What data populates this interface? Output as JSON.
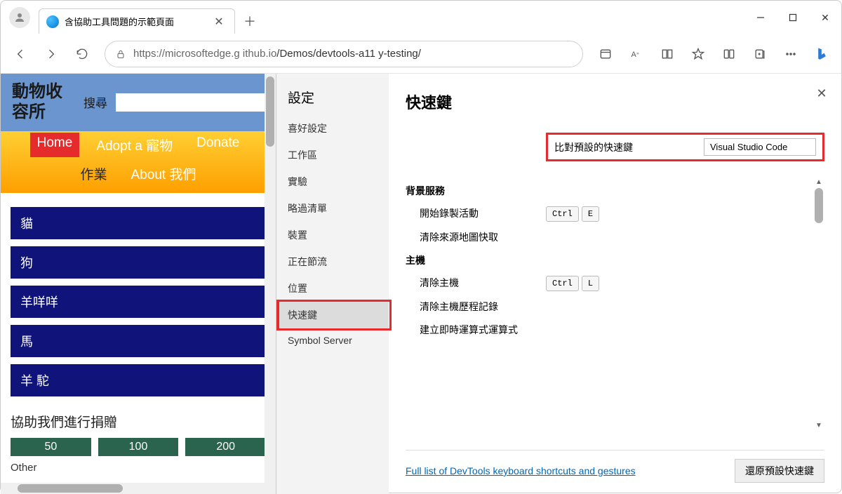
{
  "browser": {
    "tab_title": "含協助工具問題的示範頁面",
    "url_host": "https://microsoftedge.g ithub.io",
    "url_path": "/Demos/devtools-a11 y-testing/"
  },
  "site": {
    "title": "動物收容所",
    "search_label": "搜尋",
    "nav": [
      "Home",
      "Adopt a 寵物",
      "Donate",
      "作業",
      "About 我們"
    ],
    "animals": [
      "貓",
      "狗",
      "羊咩咩",
      "馬",
      "羊 駝"
    ],
    "donate_heading": "協助我們進行捐贈",
    "donate_amounts": [
      "50",
      "100",
      "200"
    ],
    "other_label": "Other"
  },
  "devtools": {
    "settings_title": "設定",
    "nav_items": [
      "喜好設定",
      "工作區",
      "實驗",
      "略過清單",
      "裝置",
      "正在節流",
      "位置",
      "快速鍵",
      "Symbol Server"
    ],
    "nav_selected": "快速鍵",
    "main_title": "快速鍵",
    "preset_label": "比對預設的快速鍵",
    "preset_value": "Visual Studio Code",
    "sections": [
      {
        "title": "背景服務",
        "rows": [
          {
            "label": "開始錄製活動",
            "keys": [
              "Ctrl",
              "E"
            ]
          },
          {
            "label": "清除來源地圖快取",
            "keys": []
          }
        ]
      },
      {
        "title": "主機",
        "rows": [
          {
            "label": "清除主機",
            "keys": [
              "Ctrl",
              "L"
            ]
          },
          {
            "label": "清除主機歷程記錄",
            "keys": []
          },
          {
            "label": "建立即時運算式運算式",
            "keys": []
          }
        ]
      }
    ],
    "footer_link": "Full list of DevTools keyboard shortcuts and gestures",
    "restore_btn": "還原預設快速鍵"
  }
}
